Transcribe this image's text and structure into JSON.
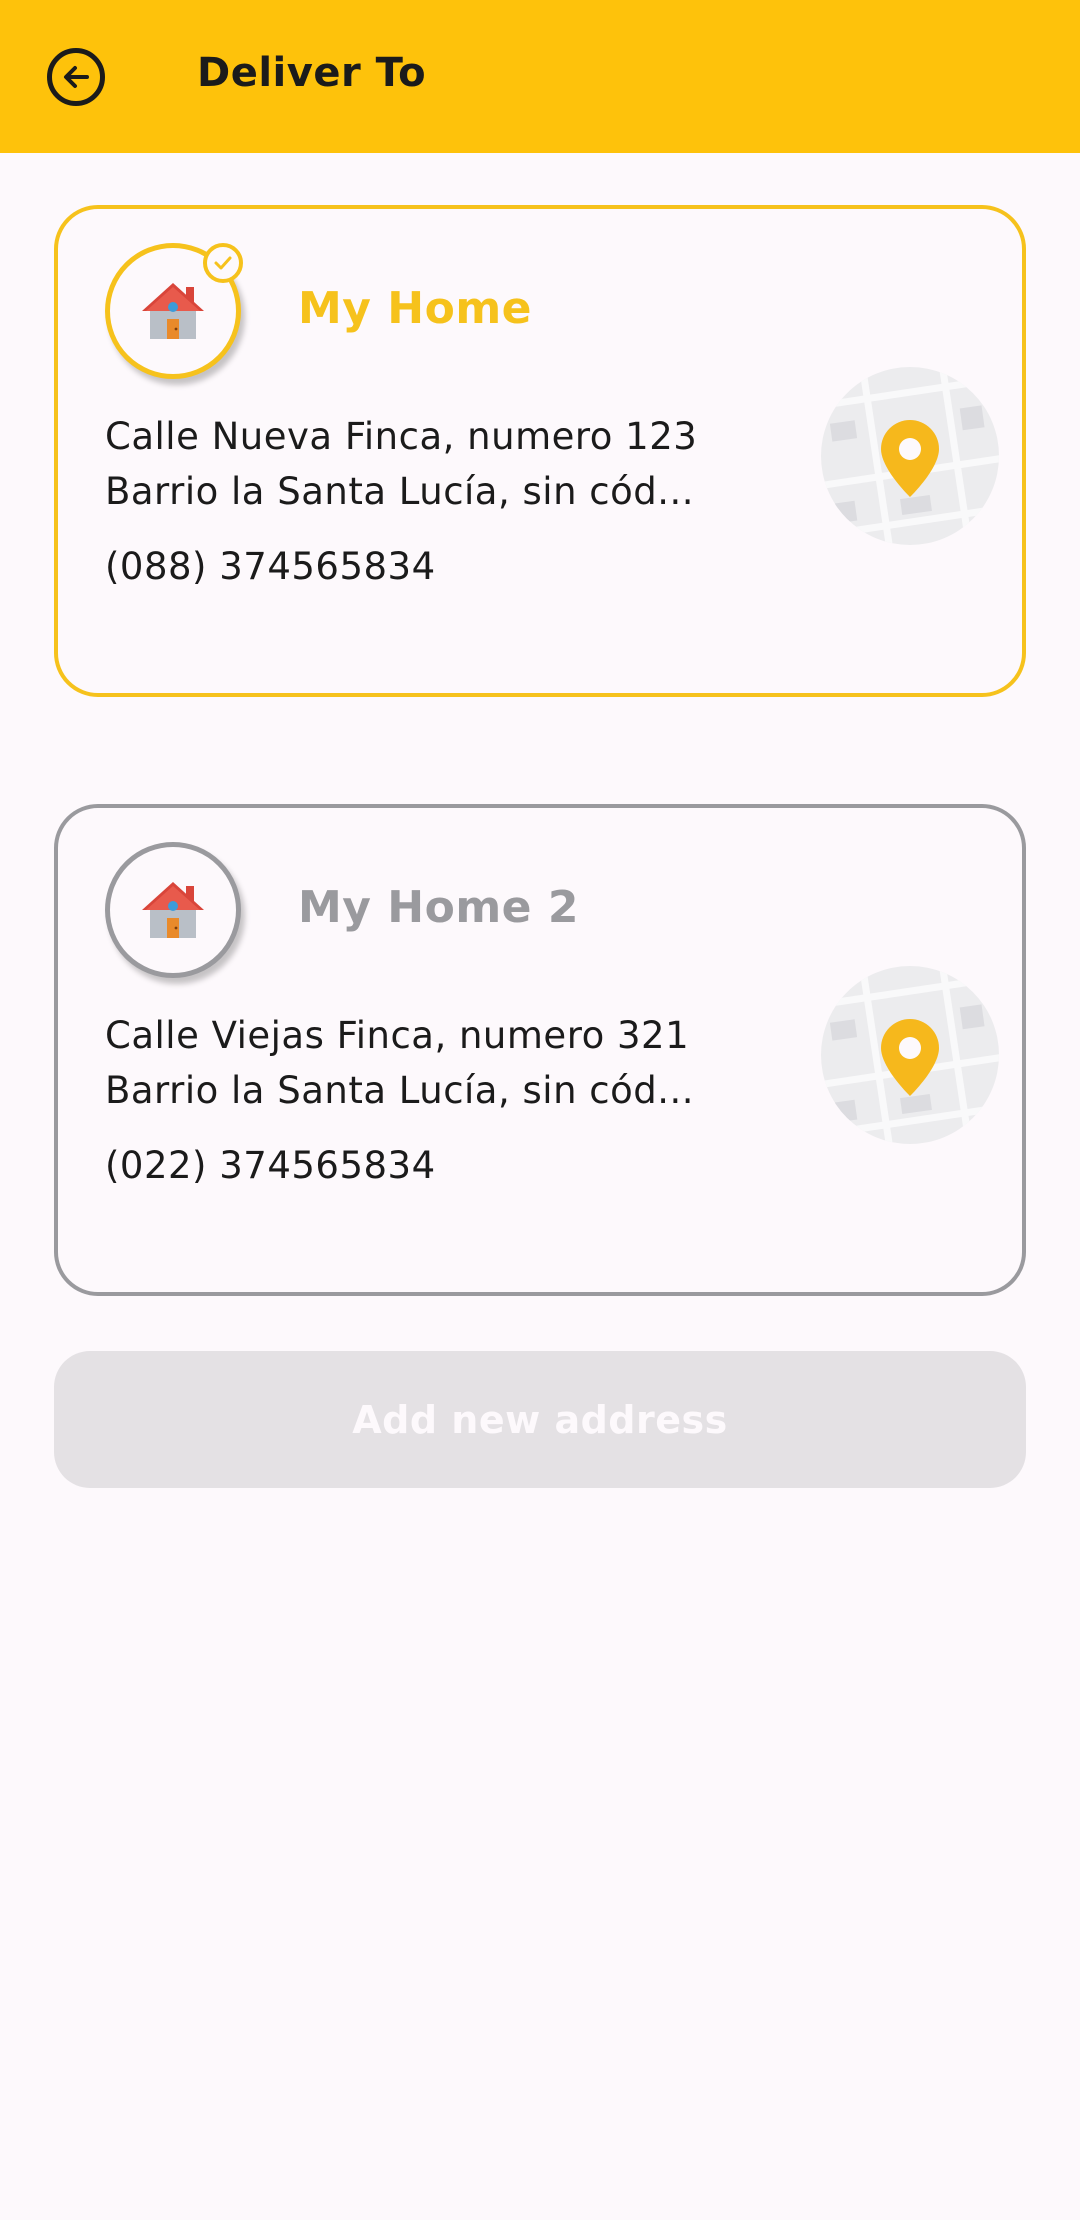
{
  "appbar": {
    "title": "Deliver To",
    "back_icon": "arrow-left-circle-icon",
    "background_color": "#fec20b"
  },
  "addresses": [
    {
      "name": "My Home",
      "line1": "Calle Nueva Finca, numero 123",
      "line2": "Barrio la Santa Lucía, sin cód...",
      "phone": "(088) 374565834",
      "selected": true,
      "icon": "house-icon",
      "accent_color": "#f6c21c"
    },
    {
      "name": "My Home 2",
      "line1": "Calle Viejas Finca, numero 321",
      "line2": "Barrio la Santa Lucía, sin cód...",
      "phone": "(022) 374565834",
      "selected": false,
      "icon": "house-icon",
      "accent_color": "#9a9a9e"
    }
  ],
  "add_button": {
    "label": "Add new address",
    "enabled": false
  }
}
